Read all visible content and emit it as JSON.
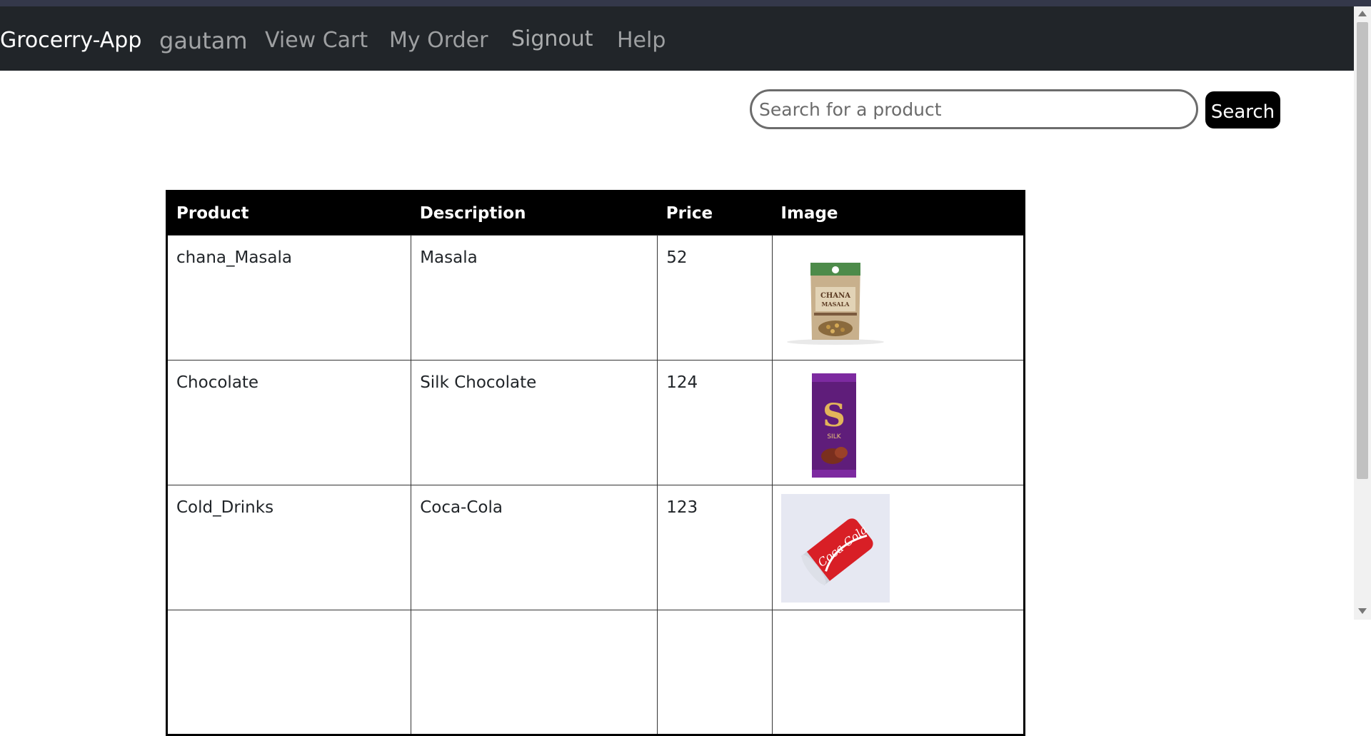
{
  "navbar": {
    "brand": "Grocerry-App",
    "user": "gautam",
    "links": [
      "View Cart",
      "My Order",
      "Signout",
      "Help"
    ]
  },
  "search": {
    "placeholder": "Search for a product",
    "button_label": "Search"
  },
  "table": {
    "headers": [
      "Product",
      "Description",
      "Price",
      "Image"
    ],
    "rows": [
      {
        "product": "chana_Masala",
        "description": "Masala",
        "price": "52",
        "image": "chana-masala-packet-image"
      },
      {
        "product": "Chocolate",
        "description": "Silk Chocolate",
        "price": "124",
        "image": "silk-chocolate-bar-image"
      },
      {
        "product": "Cold_Drinks",
        "description": "Coca-Cola",
        "price": "123",
        "image": "coca-cola-can-image"
      }
    ]
  },
  "images": {
    "chana_wordmark": "CHANA MASALA",
    "silk_wordmark": "SILK",
    "coke_wordmark": "Coca-Cola"
  },
  "colors": {
    "navbar_bg": "#212529",
    "table_header_bg": "#000000",
    "search_button_bg": "#000000"
  }
}
